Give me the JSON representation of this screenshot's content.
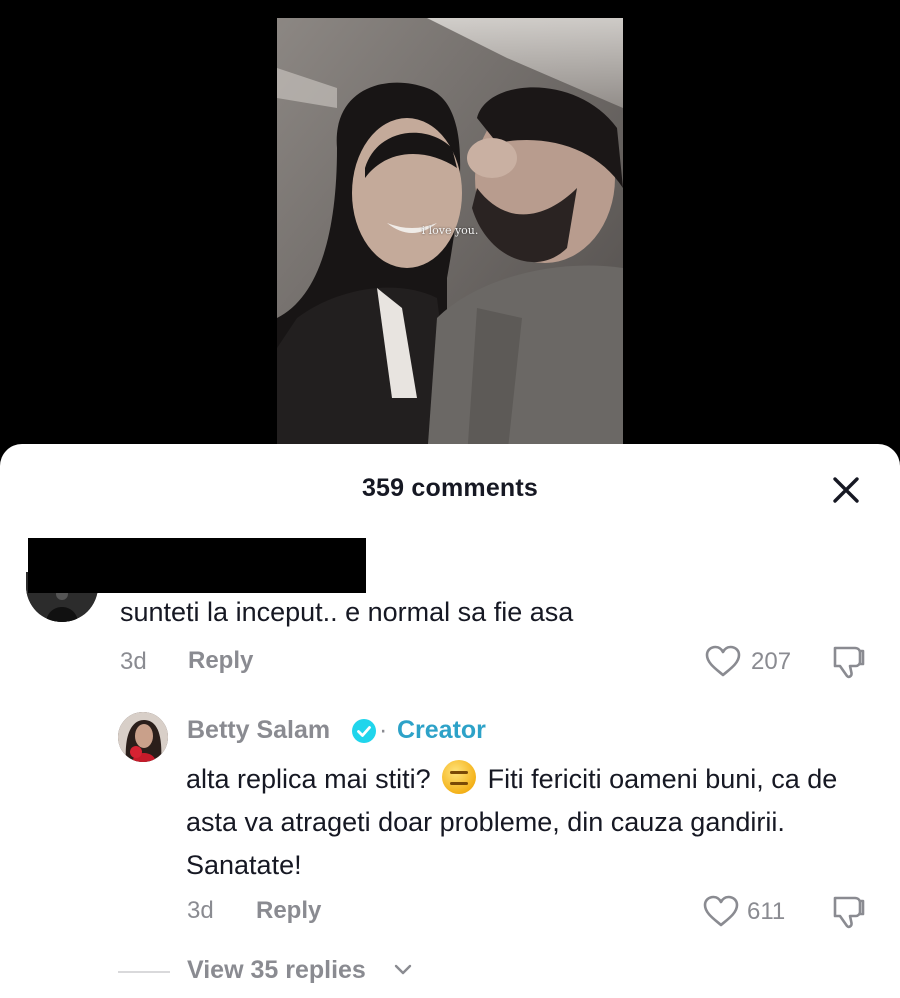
{
  "video": {
    "caption": "i love you."
  },
  "comments_sheet": {
    "title": "359 comments",
    "comments": [
      {
        "text": "sunteti la inceput.. e normal sa fie asa",
        "time": "3d",
        "reply_label": "Reply",
        "likes": "207"
      }
    ],
    "reply": {
      "author": "Betty Salam",
      "separator": "·",
      "role": "Creator",
      "text_before_emoji": "alta replica mai stiti?",
      "emoji": "expressionless-face",
      "text_after_emoji": "Fiti fericiti oameni buni, ca de asta va atrageti doar probleme, din cauza gandirii. Sanatate!",
      "time": "3d",
      "reply_label": "Reply",
      "likes": "611"
    },
    "view_replies": "View 35 replies"
  },
  "colors": {
    "accent_creator": "#2da2c8",
    "text_primary": "#161823",
    "text_secondary": "#8a8b91"
  }
}
